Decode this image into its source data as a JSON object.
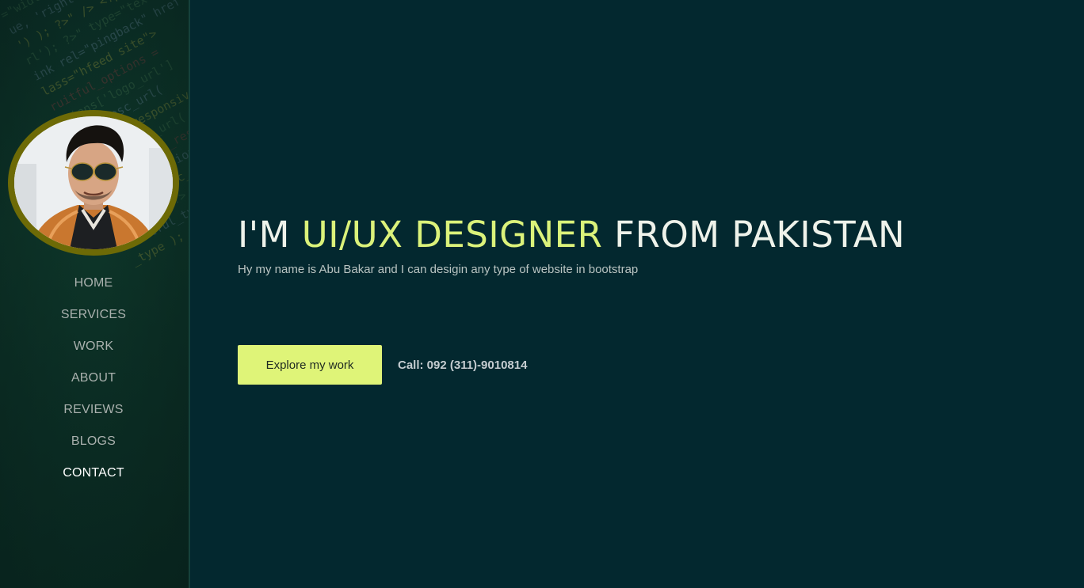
{
  "sidebar": {
    "avatar_alt": "Profile photo",
    "nav": [
      {
        "label": "HOME"
      },
      {
        "label": "SERVICES"
      },
      {
        "label": "WORK"
      },
      {
        "label": "ABOUT"
      },
      {
        "label": "REVIEWS"
      },
      {
        "label": "BLOGS"
      },
      {
        "label": "CONTACT"
      }
    ],
    "active_item": "CONTACT"
  },
  "hero": {
    "heading_prefix": "I'M ",
    "heading_accent": "UI/UX DESIGNER",
    "heading_suffix": " FROM PAKISTAN",
    "lead": "Hy my name is Abu Bakar and I can desigin any type of website in bootstrap",
    "cta_label": "Explore my work",
    "call_text": "Call: 092 (311)-9010814"
  },
  "colors": {
    "background": "#03282f",
    "accent": "#dbf27a",
    "button": "#dff478",
    "avatar_ring": "#6d6a06"
  }
}
